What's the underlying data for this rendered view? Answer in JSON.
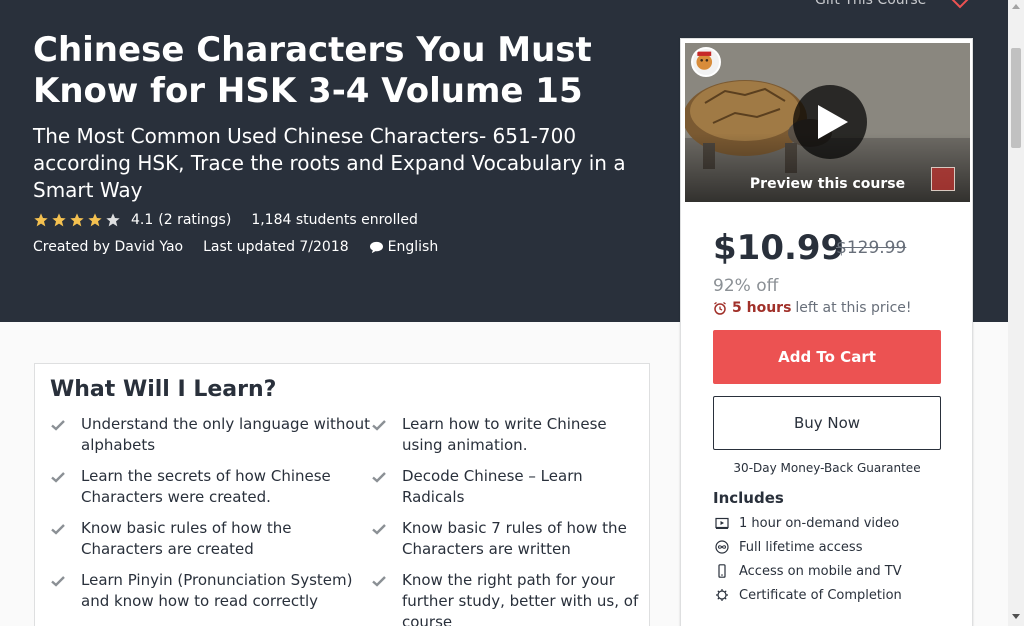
{
  "header": {
    "gift_label": "Gift This Course",
    "wishlist_icon": "heart-icon"
  },
  "course": {
    "title": "Chinese Characters You Must Know for HSK 3-4 Volume 15",
    "subtitle": "The Most Common Used Chinese Characters- 651-700 according HSK, Trace the roots and Expand Vocabulary in a Smart Way",
    "rating_value": "4.1",
    "rating_count": "(2 ratings)",
    "rating_stars": 4.1,
    "enrolled": "1,184 students enrolled",
    "created_by": "Created by David Yao",
    "last_updated": "Last updated 7/2018",
    "language": "English"
  },
  "sidebar": {
    "preview_label": "Preview this course",
    "price": "$10.99",
    "original_price": "$129.99",
    "discount": "92% off",
    "timer_bold": "5 hours",
    "timer_text": "left at this price!",
    "add_to_cart": "Add To Cart",
    "buy_now": "Buy Now",
    "guarantee": "30-Day Money-Back Guarantee",
    "includes_heading": "Includes",
    "includes": [
      {
        "icon": "video-icon",
        "label": "1 hour on-demand video"
      },
      {
        "icon": "infinity-icon",
        "label": "Full lifetime access"
      },
      {
        "icon": "mobile-icon",
        "label": "Access on mobile and TV"
      },
      {
        "icon": "certificate-icon",
        "label": "Certificate of Completion"
      }
    ]
  },
  "learn": {
    "heading": "What Will I Learn?",
    "items": [
      "Understand the only language without alphabets",
      "Learn how to write Chinese using animation.",
      "Learn the secrets of how Chinese Characters were created.",
      "Decode Chinese – Learn Radicals",
      "Know basic rules of how the Characters are created",
      "Know basic 7 rules of how the Characters are written",
      "Learn Pinyin (Pronunciation System) and know how to read correctly",
      "Know the right path for your further study, better with us, of course"
    ]
  },
  "colors": {
    "hero_bg": "#29303b",
    "cart_button": "#ec5252",
    "star": "#f4c150",
    "timer_accent": "#a1312a"
  }
}
